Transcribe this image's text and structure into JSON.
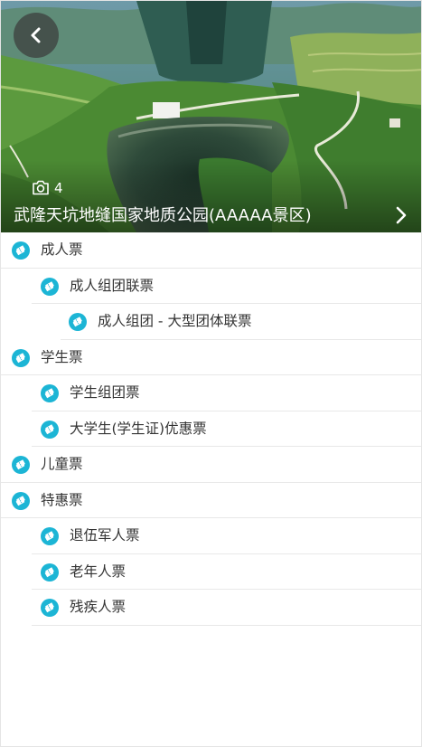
{
  "hero": {
    "photo_count": "4",
    "title": "武隆天坑地缝国家地质公园(AAAAA景区)"
  },
  "tickets": [
    {
      "label": "成人票",
      "level": 0
    },
    {
      "label": "成人组团联票",
      "level": 1
    },
    {
      "label": "成人组团 - 大型团体联票",
      "level": 2
    },
    {
      "label": "学生票",
      "level": 0
    },
    {
      "label": "学生组团票",
      "level": 1
    },
    {
      "label": "大学生(学生证)优惠票",
      "level": 1
    },
    {
      "label": "儿童票",
      "level": 0
    },
    {
      "label": "特惠票",
      "level": 0
    },
    {
      "label": "退伍军人票",
      "level": 1
    },
    {
      "label": "老年人票",
      "level": 1
    },
    {
      "label": "残疾人票",
      "level": 1
    }
  ],
  "colors": {
    "icon_accent": "#1cb5d5",
    "divider": "#e8e8e8"
  },
  "icons": {
    "back": "chevron-left-icon",
    "photo": "camera-icon",
    "detail": "chevron-right-icon",
    "ticket": "ticket-icon"
  }
}
